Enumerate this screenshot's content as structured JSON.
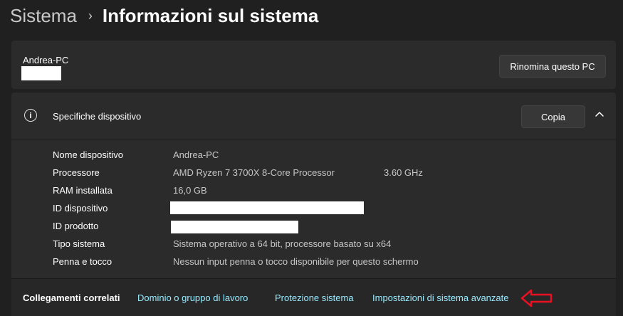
{
  "breadcrumb": {
    "parent": "Sistema",
    "separator": "›",
    "current": "Informazioni sul sistema"
  },
  "pc_card": {
    "name": "Andrea-PC",
    "rename_button": "Rinomina questo PC"
  },
  "specs": {
    "icon": "info-icon",
    "title": "Specifiche dispositivo",
    "copy_button": "Copia",
    "collapse_icon": "chevron-up-icon",
    "rows": [
      {
        "label": "Nome dispositivo",
        "value": "Andrea-PC"
      },
      {
        "label": "Processore",
        "value": "AMD Ryzen 7 3700X 8-Core Processor",
        "extra": "3.60 GHz"
      },
      {
        "label": "RAM installata",
        "value": "16,0 GB"
      },
      {
        "label": "ID dispositivo",
        "value": ""
      },
      {
        "label": "ID prodotto",
        "value": ""
      },
      {
        "label": "Tipo sistema",
        "value": "Sistema operativo a 64 bit, processore basato su x64"
      },
      {
        "label": "Penna e tocco",
        "value": "Nessun input penna o tocco disponibile per questo schermo"
      }
    ]
  },
  "related": {
    "label": "Collegamenti correlati",
    "links": [
      "Dominio o gruppo di lavoro",
      "Protezione sistema",
      "Impostazioni di sistema avanzate"
    ]
  },
  "colors": {
    "background": "#202020",
    "card": "#2b2b2b",
    "link": "#99ebff",
    "annotation_arrow": "#e81123",
    "redaction": "#ffffff"
  }
}
